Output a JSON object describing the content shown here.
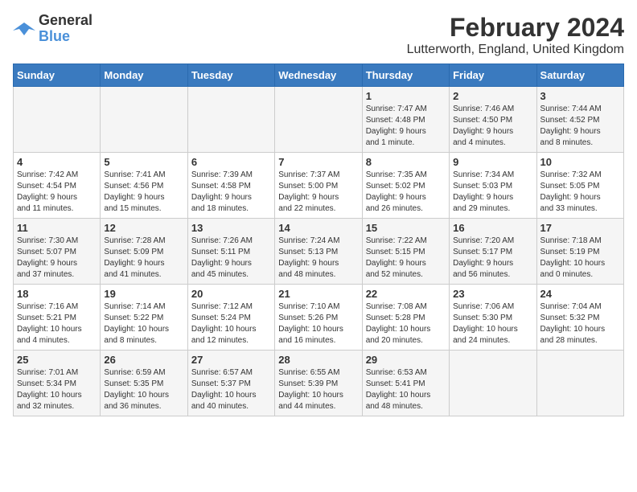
{
  "logo": {
    "text_general": "General",
    "text_blue": "Blue"
  },
  "title": "February 2024",
  "subtitle": "Lutterworth, England, United Kingdom",
  "days_of_week": [
    "Sunday",
    "Monday",
    "Tuesday",
    "Wednesday",
    "Thursday",
    "Friday",
    "Saturday"
  ],
  "weeks": [
    [
      {
        "day": "",
        "info": ""
      },
      {
        "day": "",
        "info": ""
      },
      {
        "day": "",
        "info": ""
      },
      {
        "day": "",
        "info": ""
      },
      {
        "day": "1",
        "info": "Sunrise: 7:47 AM\nSunset: 4:48 PM\nDaylight: 9 hours\nand 1 minute."
      },
      {
        "day": "2",
        "info": "Sunrise: 7:46 AM\nSunset: 4:50 PM\nDaylight: 9 hours\nand 4 minutes."
      },
      {
        "day": "3",
        "info": "Sunrise: 7:44 AM\nSunset: 4:52 PM\nDaylight: 9 hours\nand 8 minutes."
      }
    ],
    [
      {
        "day": "4",
        "info": "Sunrise: 7:42 AM\nSunset: 4:54 PM\nDaylight: 9 hours\nand 11 minutes."
      },
      {
        "day": "5",
        "info": "Sunrise: 7:41 AM\nSunset: 4:56 PM\nDaylight: 9 hours\nand 15 minutes."
      },
      {
        "day": "6",
        "info": "Sunrise: 7:39 AM\nSunset: 4:58 PM\nDaylight: 9 hours\nand 18 minutes."
      },
      {
        "day": "7",
        "info": "Sunrise: 7:37 AM\nSunset: 5:00 PM\nDaylight: 9 hours\nand 22 minutes."
      },
      {
        "day": "8",
        "info": "Sunrise: 7:35 AM\nSunset: 5:02 PM\nDaylight: 9 hours\nand 26 minutes."
      },
      {
        "day": "9",
        "info": "Sunrise: 7:34 AM\nSunset: 5:03 PM\nDaylight: 9 hours\nand 29 minutes."
      },
      {
        "day": "10",
        "info": "Sunrise: 7:32 AM\nSunset: 5:05 PM\nDaylight: 9 hours\nand 33 minutes."
      }
    ],
    [
      {
        "day": "11",
        "info": "Sunrise: 7:30 AM\nSunset: 5:07 PM\nDaylight: 9 hours\nand 37 minutes."
      },
      {
        "day": "12",
        "info": "Sunrise: 7:28 AM\nSunset: 5:09 PM\nDaylight: 9 hours\nand 41 minutes."
      },
      {
        "day": "13",
        "info": "Sunrise: 7:26 AM\nSunset: 5:11 PM\nDaylight: 9 hours\nand 45 minutes."
      },
      {
        "day": "14",
        "info": "Sunrise: 7:24 AM\nSunset: 5:13 PM\nDaylight: 9 hours\nand 48 minutes."
      },
      {
        "day": "15",
        "info": "Sunrise: 7:22 AM\nSunset: 5:15 PM\nDaylight: 9 hours\nand 52 minutes."
      },
      {
        "day": "16",
        "info": "Sunrise: 7:20 AM\nSunset: 5:17 PM\nDaylight: 9 hours\nand 56 minutes."
      },
      {
        "day": "17",
        "info": "Sunrise: 7:18 AM\nSunset: 5:19 PM\nDaylight: 10 hours\nand 0 minutes."
      }
    ],
    [
      {
        "day": "18",
        "info": "Sunrise: 7:16 AM\nSunset: 5:21 PM\nDaylight: 10 hours\nand 4 minutes."
      },
      {
        "day": "19",
        "info": "Sunrise: 7:14 AM\nSunset: 5:22 PM\nDaylight: 10 hours\nand 8 minutes."
      },
      {
        "day": "20",
        "info": "Sunrise: 7:12 AM\nSunset: 5:24 PM\nDaylight: 10 hours\nand 12 minutes."
      },
      {
        "day": "21",
        "info": "Sunrise: 7:10 AM\nSunset: 5:26 PM\nDaylight: 10 hours\nand 16 minutes."
      },
      {
        "day": "22",
        "info": "Sunrise: 7:08 AM\nSunset: 5:28 PM\nDaylight: 10 hours\nand 20 minutes."
      },
      {
        "day": "23",
        "info": "Sunrise: 7:06 AM\nSunset: 5:30 PM\nDaylight: 10 hours\nand 24 minutes."
      },
      {
        "day": "24",
        "info": "Sunrise: 7:04 AM\nSunset: 5:32 PM\nDaylight: 10 hours\nand 28 minutes."
      }
    ],
    [
      {
        "day": "25",
        "info": "Sunrise: 7:01 AM\nSunset: 5:34 PM\nDaylight: 10 hours\nand 32 minutes."
      },
      {
        "day": "26",
        "info": "Sunrise: 6:59 AM\nSunset: 5:35 PM\nDaylight: 10 hours\nand 36 minutes."
      },
      {
        "day": "27",
        "info": "Sunrise: 6:57 AM\nSunset: 5:37 PM\nDaylight: 10 hours\nand 40 minutes."
      },
      {
        "day": "28",
        "info": "Sunrise: 6:55 AM\nSunset: 5:39 PM\nDaylight: 10 hours\nand 44 minutes."
      },
      {
        "day": "29",
        "info": "Sunrise: 6:53 AM\nSunset: 5:41 PM\nDaylight: 10 hours\nand 48 minutes."
      },
      {
        "day": "",
        "info": ""
      },
      {
        "day": "",
        "info": ""
      }
    ]
  ]
}
